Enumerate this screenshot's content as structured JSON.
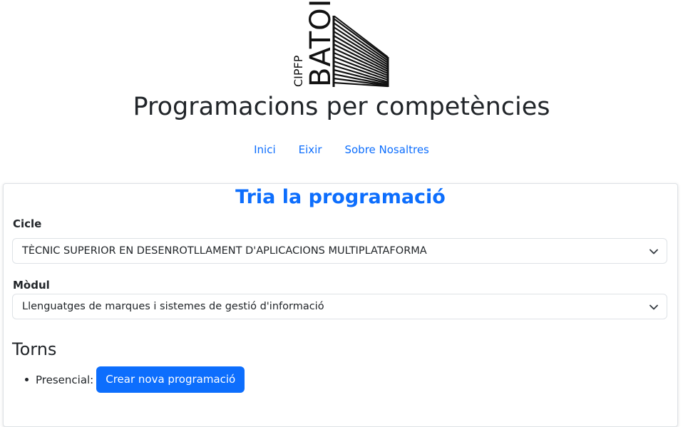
{
  "logo": {
    "cipfp": "CIPFP",
    "batoi": "BATOI"
  },
  "header": {
    "title": "Programacions per competències"
  },
  "nav": {
    "items": [
      "Inici",
      "Eixir",
      "Sobre Nosaltres"
    ]
  },
  "form": {
    "heading": "Tria la programació",
    "cicle_label": "Cicle",
    "cicle_value": "TÈCNIC SUPERIOR EN DESENROTLLAMENT D'APLICACIONS MULTIPLATAFORMA",
    "modul_label": "Mòdul",
    "modul_value": "Llenguatges de marques i sistemes de gestió d'informació"
  },
  "torns": {
    "heading": "Torns",
    "items": [
      {
        "label": "Presencial:",
        "button": "Crear nova programació"
      }
    ]
  },
  "colors": {
    "accent": "#0d6efd",
    "text": "#212529",
    "border": "#dee2e6"
  }
}
